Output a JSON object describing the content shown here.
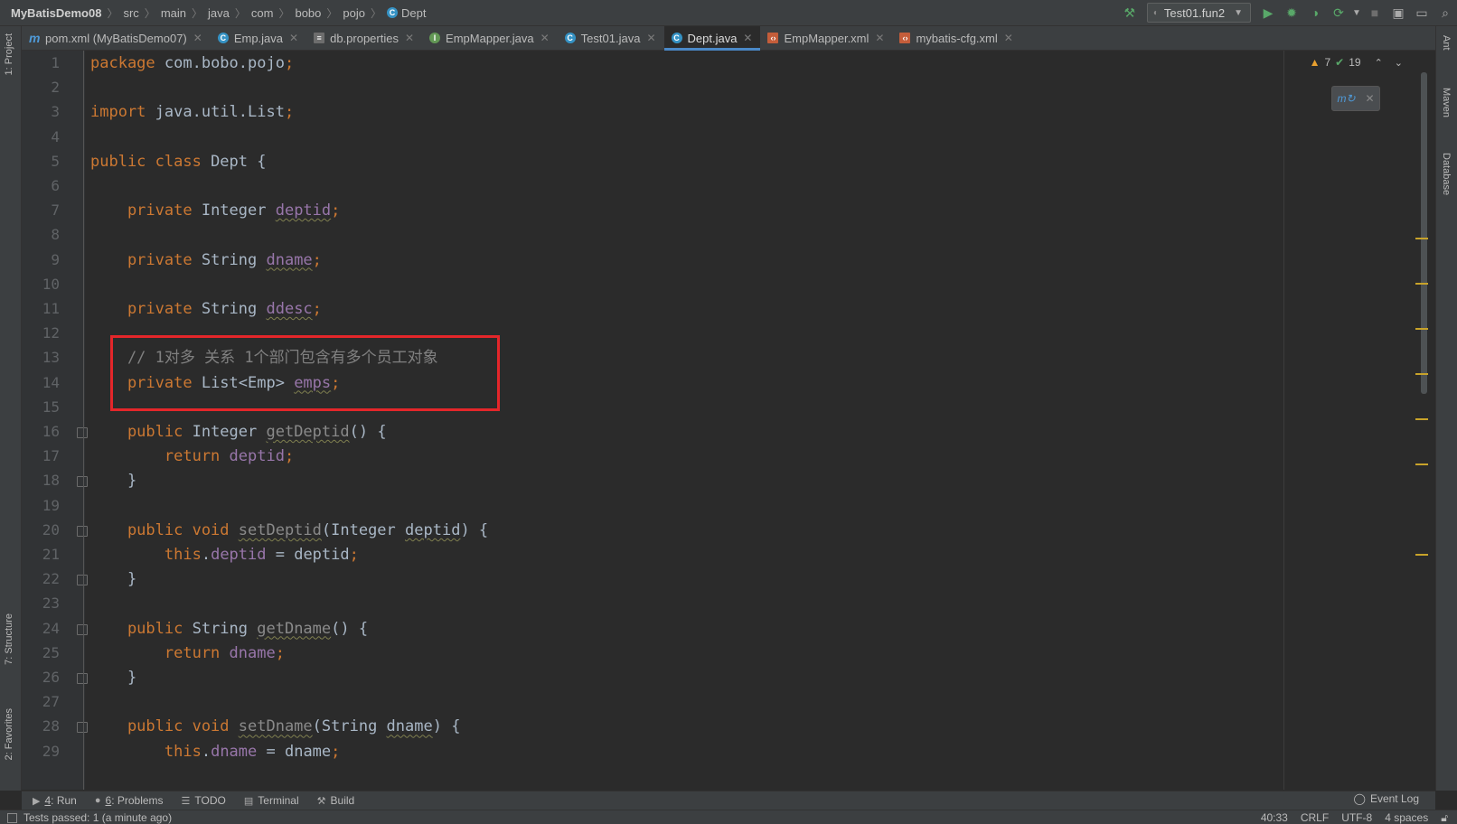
{
  "breadcrumb": [
    "MyBatisDemo08",
    "src",
    "main",
    "java",
    "com",
    "bobo",
    "pojo",
    "Dept"
  ],
  "breadcrumb_icon": "class-icon",
  "run_config": "Test01.fun2",
  "tabs": [
    {
      "label": "pom.xml (MyBatisDemo07)",
      "icon": "maven-icon",
      "active": false
    },
    {
      "label": "Emp.java",
      "icon": "class-icon",
      "active": false
    },
    {
      "label": "db.properties",
      "icon": "properties-icon",
      "active": false
    },
    {
      "label": "EmpMapper.java",
      "icon": "interface-icon",
      "active": false
    },
    {
      "label": "Test01.java",
      "icon": "test-class-icon",
      "active": false
    },
    {
      "label": "Dept.java",
      "icon": "class-icon",
      "active": true
    },
    {
      "label": "EmpMapper.xml",
      "icon": "xml-icon",
      "active": false
    },
    {
      "label": "mybatis-cfg.xml",
      "icon": "xml-icon",
      "active": false
    }
  ],
  "left_tools": [
    "1: Project",
    "7: Structure",
    "2: Favorites"
  ],
  "right_tools": [
    "Ant",
    "Maven",
    "Database"
  ],
  "inspections": {
    "warnings": "7",
    "ok": "19"
  },
  "line_numbers": [
    "1",
    "2",
    "3",
    "4",
    "5",
    "6",
    "7",
    "8",
    "9",
    "10",
    "11",
    "12",
    "13",
    "14",
    "15",
    "16",
    "17",
    "18",
    "19",
    "20",
    "21",
    "22",
    "23",
    "24",
    "25",
    "26",
    "27",
    "28",
    "29"
  ],
  "code": [
    {
      "line": 1,
      "tokens": [
        [
          "kw",
          "package "
        ],
        [
          "ty",
          "com.bobo.pojo"
        ],
        [
          "kw",
          ";"
        ]
      ]
    },
    {
      "line": 2,
      "tokens": []
    },
    {
      "line": 3,
      "tokens": [
        [
          "kw",
          "import "
        ],
        [
          "ty",
          "java.util.List"
        ],
        [
          "kw",
          ";"
        ]
      ]
    },
    {
      "line": 4,
      "tokens": []
    },
    {
      "line": 5,
      "tokens": [
        [
          "kw",
          "public class "
        ],
        [
          "ty",
          "Dept {"
        ]
      ]
    },
    {
      "line": 6,
      "tokens": []
    },
    {
      "line": 7,
      "tokens": [
        [
          "kw",
          "    private "
        ],
        [
          "ty",
          "Integer "
        ],
        [
          "field squig",
          "deptid"
        ],
        [
          "kw",
          ";"
        ]
      ]
    },
    {
      "line": 8,
      "tokens": []
    },
    {
      "line": 9,
      "tokens": [
        [
          "kw",
          "    private "
        ],
        [
          "ty",
          "String "
        ],
        [
          "field squig",
          "dname"
        ],
        [
          "kw",
          ";"
        ]
      ]
    },
    {
      "line": 10,
      "tokens": []
    },
    {
      "line": 11,
      "tokens": [
        [
          "kw",
          "    private "
        ],
        [
          "ty",
          "String "
        ],
        [
          "field squig",
          "ddesc"
        ],
        [
          "kw",
          ";"
        ]
      ]
    },
    {
      "line": 12,
      "tokens": []
    },
    {
      "line": 13,
      "tokens": [
        [
          "cmt",
          "    // 1对多 关系 1个部门包含有多个员工对象"
        ]
      ]
    },
    {
      "line": 14,
      "tokens": [
        [
          "kw",
          "    private "
        ],
        [
          "ty",
          "List<Emp> "
        ],
        [
          "field squig",
          "emps"
        ],
        [
          "kw",
          ";"
        ]
      ]
    },
    {
      "line": 15,
      "tokens": []
    },
    {
      "line": 16,
      "tokens": [
        [
          "kw",
          "    public "
        ],
        [
          "ty",
          "Integer "
        ],
        [
          "dim squig",
          "getDeptid"
        ],
        [
          "ty",
          "() {"
        ]
      ]
    },
    {
      "line": 17,
      "tokens": [
        [
          "kw",
          "        return "
        ],
        [
          "field",
          "deptid"
        ],
        [
          "kw",
          ";"
        ]
      ]
    },
    {
      "line": 18,
      "tokens": [
        [
          "ty",
          "    }"
        ]
      ]
    },
    {
      "line": 19,
      "tokens": []
    },
    {
      "line": 20,
      "tokens": [
        [
          "kw",
          "    public void "
        ],
        [
          "dim squig",
          "setDeptid"
        ],
        [
          "ty",
          "(Integer "
        ],
        [
          "ty squig",
          "deptid"
        ],
        [
          "ty",
          ") {"
        ]
      ]
    },
    {
      "line": 21,
      "tokens": [
        [
          "kw",
          "        this"
        ],
        [
          "ty",
          "."
        ],
        [
          "field",
          "deptid"
        ],
        [
          "ty",
          " = deptid"
        ],
        [
          "kw",
          ";"
        ]
      ]
    },
    {
      "line": 22,
      "tokens": [
        [
          "ty",
          "    }"
        ]
      ]
    },
    {
      "line": 23,
      "tokens": []
    },
    {
      "line": 24,
      "tokens": [
        [
          "kw",
          "    public "
        ],
        [
          "ty",
          "String "
        ],
        [
          "dim squig",
          "getDname"
        ],
        [
          "ty",
          "() {"
        ]
      ]
    },
    {
      "line": 25,
      "tokens": [
        [
          "kw",
          "        return "
        ],
        [
          "field",
          "dname"
        ],
        [
          "kw",
          ";"
        ]
      ]
    },
    {
      "line": 26,
      "tokens": [
        [
          "ty",
          "    }"
        ]
      ]
    },
    {
      "line": 27,
      "tokens": []
    },
    {
      "line": 28,
      "tokens": [
        [
          "kw",
          "    public void "
        ],
        [
          "dim squig",
          "setDname"
        ],
        [
          "ty",
          "(String "
        ],
        [
          "ty squig",
          "dname"
        ],
        [
          "ty",
          ") {"
        ]
      ]
    },
    {
      "line": 29,
      "tokens": [
        [
          "kw",
          "        this"
        ],
        [
          "ty",
          "."
        ],
        [
          "field",
          "dname"
        ],
        [
          "ty",
          " = dname"
        ],
        [
          "kw",
          ";"
        ]
      ]
    }
  ],
  "bottom_tools": [
    {
      "num": "4",
      "label": ": Run",
      "icon": "play-icon"
    },
    {
      "num": "6",
      "label": ": Problems",
      "icon": "info-icon"
    },
    {
      "num": "",
      "label": "TODO",
      "icon": "list-icon"
    },
    {
      "num": "",
      "label": "Terminal",
      "icon": "terminal-icon"
    },
    {
      "num": "",
      "label": "Build",
      "icon": "hammer-icon"
    }
  ],
  "event_log": "Event Log",
  "status": {
    "message": "Tests passed: 1 (a minute ago)",
    "position": "40:33",
    "line_sep": "CRLF",
    "encoding": "UTF-8",
    "indent": "4 spaces"
  },
  "colors": {
    "highlight_box": "#e4262a",
    "keyword": "#cc7832",
    "field": "#9876aa",
    "comment": "#808080"
  }
}
